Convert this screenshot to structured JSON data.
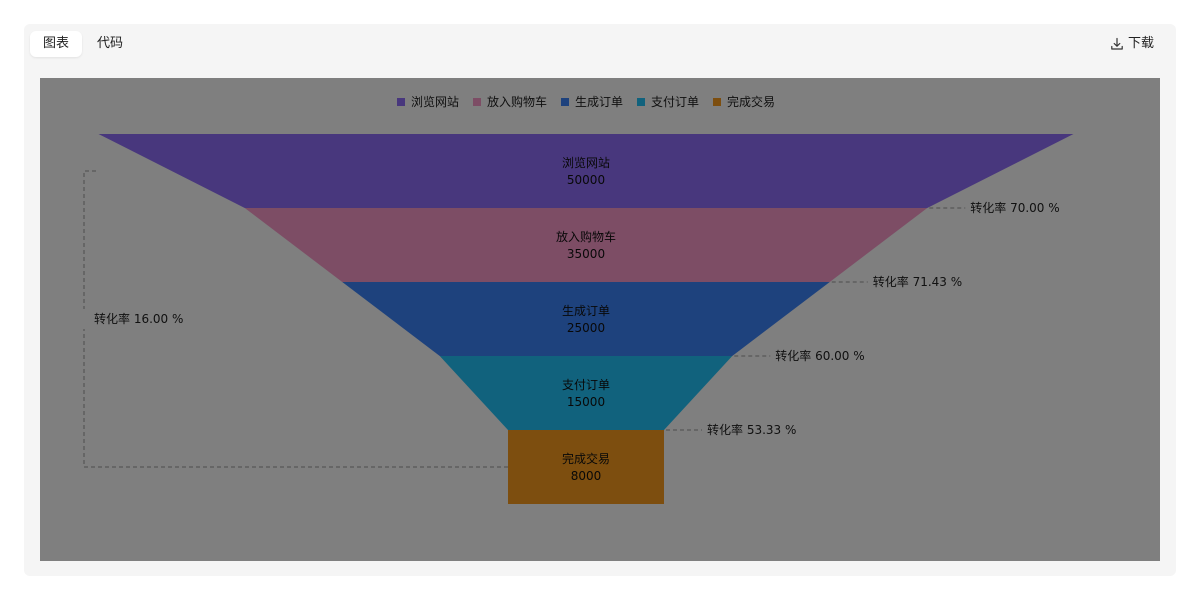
{
  "tabs": {
    "chart_label": "图表",
    "code_label": "代码"
  },
  "toolbar": {
    "download_label": "下载"
  },
  "colors": {
    "浏览网站": "#8E6CF5",
    "放入购物车": "#F597C7",
    "生成订单": "#3B82F6",
    "支付订单": "#22C0F5",
    "完成交易": "#F59A1E"
  },
  "chart_data": {
    "type": "funnel",
    "categories": [
      "浏览网站",
      "放入购物车",
      "生成订单",
      "支付订单",
      "完成交易"
    ],
    "values": [
      50000,
      35000,
      25000,
      15000,
      8000
    ],
    "series": [
      {
        "name": "浏览网站",
        "value": 50000,
        "color": "#8E6CF5"
      },
      {
        "name": "放入购物车",
        "value": 35000,
        "color": "#F597C7"
      },
      {
        "name": "生成订单",
        "value": 25000,
        "color": "#3B82F6"
      },
      {
        "name": "支付订单",
        "value": 15000,
        "color": "#22C0F5"
      },
      {
        "name": "完成交易",
        "value": 8000,
        "color": "#F59A1E"
      }
    ],
    "conversion_label": "转化率",
    "conversion_rates": [
      "70.00 %",
      "71.43 %",
      "60.00 %",
      "53.33 %"
    ],
    "overall_conversion": "16.00 %",
    "legend": {
      "position": "top",
      "items": [
        "浏览网站",
        "放入购物车",
        "生成订单",
        "支付订单",
        "完成交易"
      ]
    },
    "title": "",
    "xlabel": "",
    "ylabel": ""
  }
}
